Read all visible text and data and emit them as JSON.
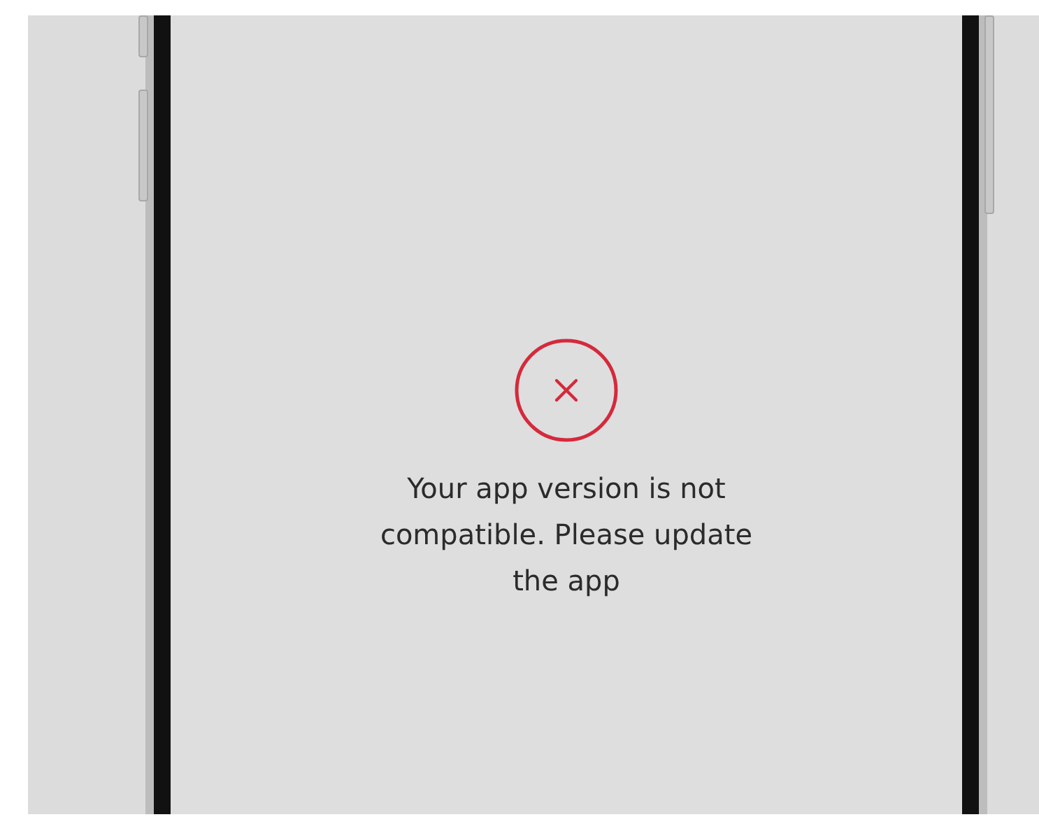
{
  "screen": {
    "failed": true,
    "message": "Your app version is not compatible. Please update the app"
  }
}
